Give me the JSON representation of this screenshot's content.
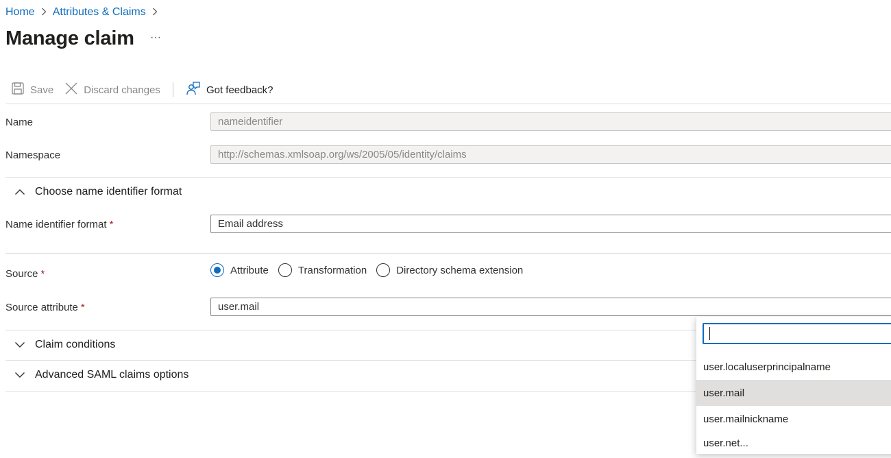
{
  "breadcrumb": {
    "home": "Home",
    "parent": "Attributes & Claims",
    "separator": ">"
  },
  "page": {
    "title": "Manage claim",
    "more": "···"
  },
  "toolbar": {
    "save": "Save",
    "discard": "Discard changes",
    "feedback": "Got feedback?"
  },
  "form": {
    "name_label": "Name",
    "name_value": "nameidentifier",
    "namespace_label": "Namespace",
    "namespace_value": "http://schemas.xmlsoap.org/ws/2005/05/identity/claims",
    "nameid_section": "Choose name identifier format",
    "nameid_format_label": "Name identifier format",
    "nameid_format_value": "Email address",
    "source_label": "Source",
    "source_options": [
      "Attribute",
      "Transformation",
      "Directory schema extension"
    ],
    "source_selected": "Attribute",
    "source_attr_label": "Source attribute",
    "source_attr_value": "user.mail",
    "required_mark": "*",
    "claim_conditions": "Claim conditions",
    "advanced": "Advanced SAML claims options"
  },
  "dropdown": {
    "search_value": "",
    "items": [
      "user.localuserprincipalname",
      "user.mail",
      "user.mailnickname",
      "user.net..."
    ],
    "selected": "user.mail"
  },
  "colors": {
    "accent": "#0f6cbd",
    "required": "#a4262c",
    "selected_bg": "#e1dfdd"
  }
}
